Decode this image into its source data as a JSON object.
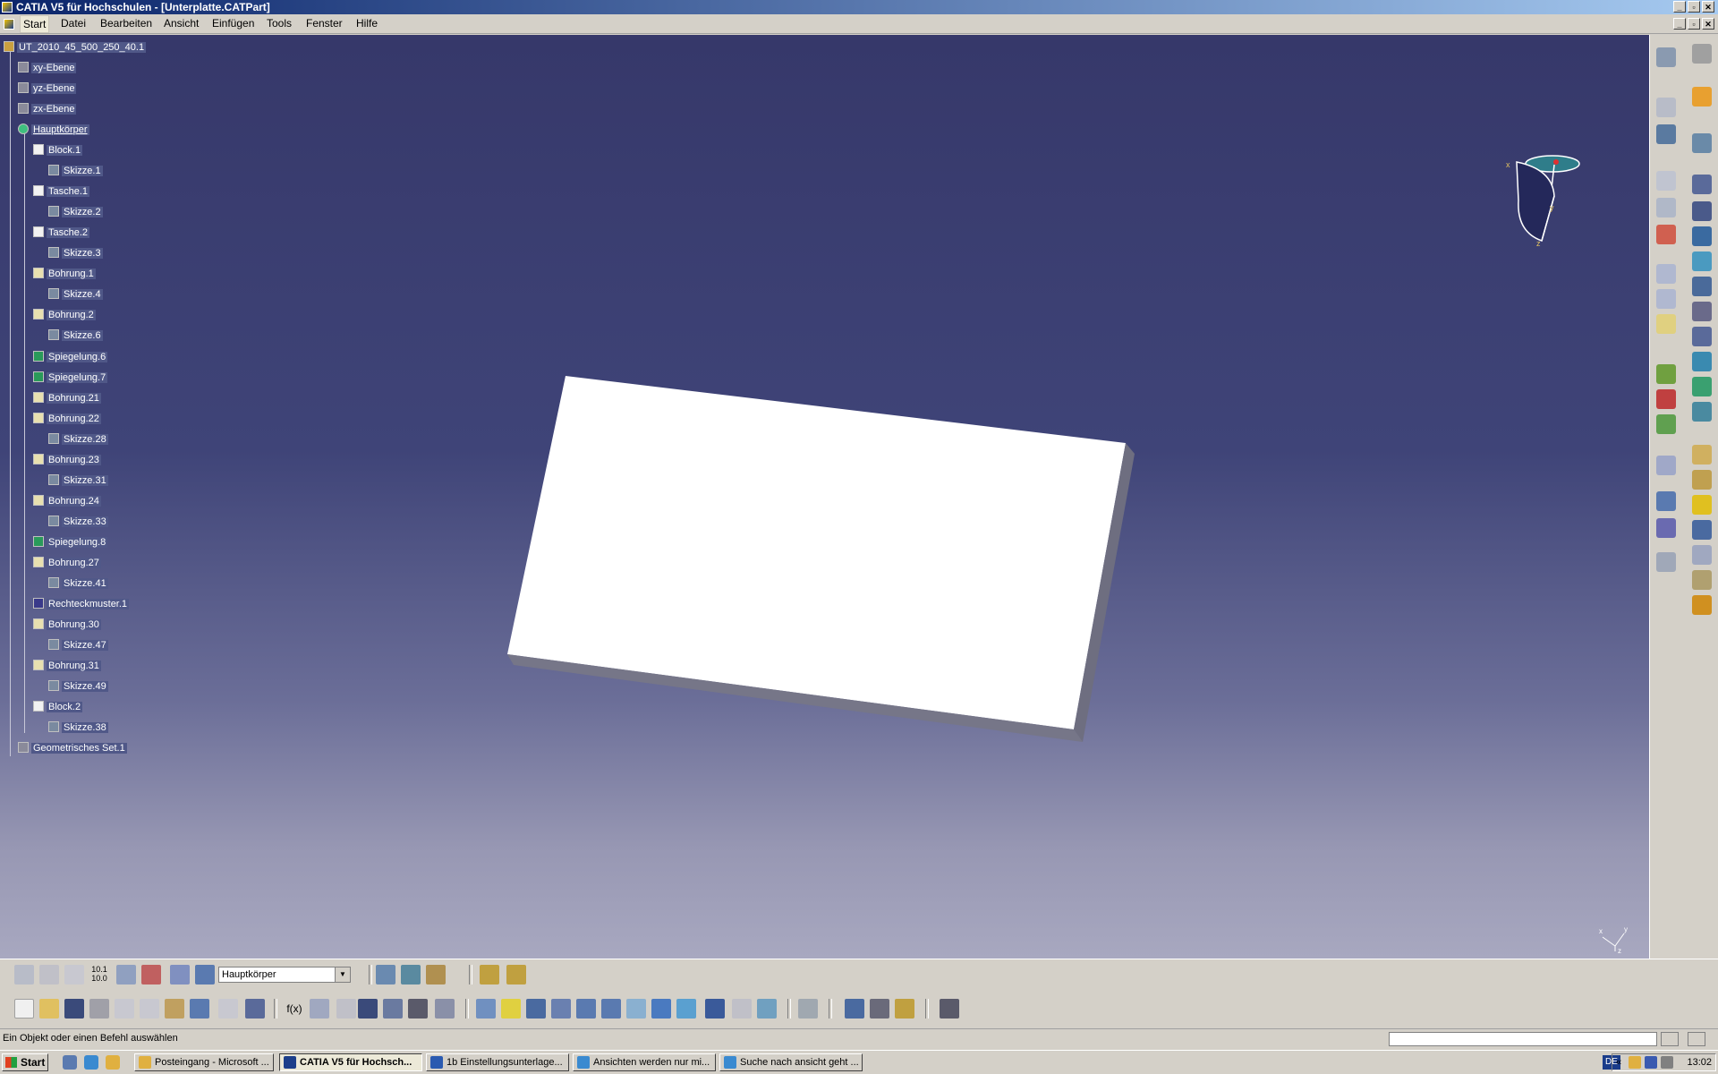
{
  "window": {
    "title": "CATIA V5 für Hochschulen - [Unterplatte.CATPart]"
  },
  "menu": [
    "Start",
    "Datei",
    "Bearbeiten",
    "Ansicht",
    "Einfügen",
    "Tools",
    "Fenster",
    "Hilfe"
  ],
  "tree": [
    {
      "label": "UT_2010_45_500_250_40.1",
      "icon": "part-icon",
      "level": 0
    },
    {
      "label": "xy-Ebene",
      "icon": "plane-icon",
      "level": 1
    },
    {
      "label": "yz-Ebene",
      "icon": "plane-icon",
      "level": 1
    },
    {
      "label": "zx-Ebene",
      "icon": "plane-icon",
      "level": 1
    },
    {
      "label": "Hauptkörper",
      "icon": "body-icon",
      "level": 1
    },
    {
      "label": "Block.1",
      "icon": "pad-icon",
      "level": 2
    },
    {
      "label": "Skizze.1",
      "icon": "sketch-icon",
      "level": 3
    },
    {
      "label": "Tasche.1",
      "icon": "pocket-icon",
      "level": 2
    },
    {
      "label": "Skizze.2",
      "icon": "sketch-icon",
      "level": 3
    },
    {
      "label": "Tasche.2",
      "icon": "pocket-icon",
      "level": 2
    },
    {
      "label": "Skizze.3",
      "icon": "sketch-icon",
      "level": 3
    },
    {
      "label": "Bohrung.1",
      "icon": "hole-icon",
      "level": 2
    },
    {
      "label": "Skizze.4",
      "icon": "sketch-icon",
      "level": 3
    },
    {
      "label": "Bohrung.2",
      "icon": "hole-icon",
      "level": 2
    },
    {
      "label": "Skizze.6",
      "icon": "sketch-icon",
      "level": 3
    },
    {
      "label": "Spiegelung.6",
      "icon": "mirror-icon",
      "level": 2
    },
    {
      "label": "Spiegelung.7",
      "icon": "mirror-icon",
      "level": 2
    },
    {
      "label": "Bohrung.21",
      "icon": "hole-icon",
      "level": 2
    },
    {
      "label": "Bohrung.22",
      "icon": "hole-icon",
      "level": 2
    },
    {
      "label": "Skizze.28",
      "icon": "sketch-icon",
      "level": 3
    },
    {
      "label": "Bohrung.23",
      "icon": "hole-icon",
      "level": 2
    },
    {
      "label": "Skizze.31",
      "icon": "sketch-icon",
      "level": 3
    },
    {
      "label": "Bohrung.24",
      "icon": "hole-icon",
      "level": 2
    },
    {
      "label": "Skizze.33",
      "icon": "sketch-icon",
      "level": 3
    },
    {
      "label": "Spiegelung.8",
      "icon": "mirror-icon",
      "level": 2
    },
    {
      "label": "Bohrung.27",
      "icon": "hole-icon",
      "level": 2
    },
    {
      "label": "Skizze.41",
      "icon": "sketch-icon",
      "level": 3
    },
    {
      "label": "Rechteckmuster.1",
      "icon": "pattern-icon",
      "level": 2
    },
    {
      "label": "Bohrung.30",
      "icon": "hole-icon",
      "level": 2
    },
    {
      "label": "Skizze.47",
      "icon": "sketch-icon",
      "level": 3
    },
    {
      "label": "Bohrung.31",
      "icon": "hole-icon",
      "level": 2
    },
    {
      "label": "Skizze.49",
      "icon": "sketch-icon",
      "level": 3
    },
    {
      "label": "Block.2",
      "icon": "pad-icon",
      "level": 2
    },
    {
      "label": "Skizze.38",
      "icon": "sketch-icon",
      "level": 3
    },
    {
      "label": "Geometrisches Set.1",
      "icon": "geometrical-set-icon",
      "level": 1
    }
  ],
  "compass": {
    "x_label": "x",
    "y_label": "y",
    "z_label": "z"
  },
  "toolbar": {
    "body_select_value": "Hauptkörper",
    "coord_icon_text_top": "10.1",
    "coord_icon_text_bottom": "10.0"
  },
  "statusbar": {
    "message": "Ein Objekt oder einen Befehl auswählen",
    "power_input_value": ""
  },
  "taskbar": {
    "start_label": "Start",
    "tasks": [
      "Posteingang - Microsoft ...",
      "CATIA V5 für Hochsch...",
      "1b Einstellungsunterlage...",
      "Ansichten werden nur mi...",
      "Suche nach ansicht geht ..."
    ],
    "lang": "DE",
    "clock": "13:02"
  },
  "colors": {
    "titlebar": "#0a246a",
    "viewport_top": "#36386a",
    "viewport_bottom": "#a8a8c0",
    "ui_gray": "#d4d0c8"
  }
}
